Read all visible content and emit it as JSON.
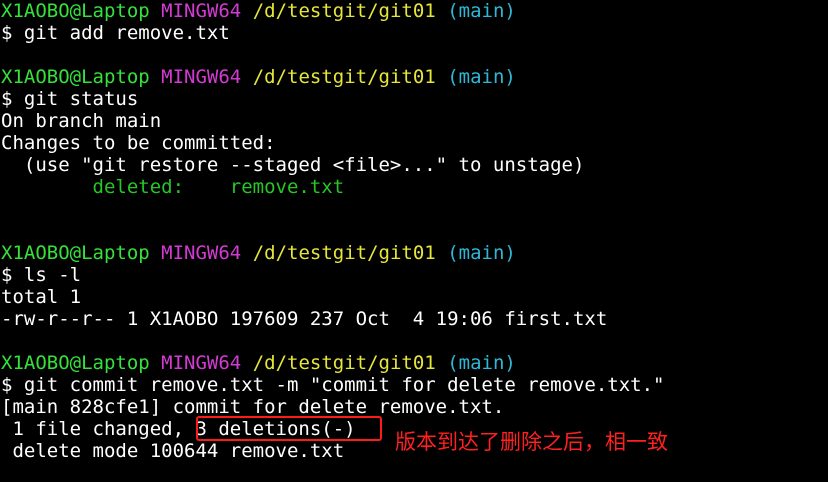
{
  "prompt": {
    "user_host": "X1AOBO@Laptop",
    "system": "MINGW64",
    "path": "/d/testgit/git01",
    "branch": "(main)"
  },
  "lines": {
    "cmd_add": "$ git add remove.txt",
    "cmd_status": "$ git status",
    "status_branch": "On branch main",
    "status_changes": "Changes to be committed:",
    "status_hint": "  (use \"git restore --staged <file>...\" to unstage)",
    "status_deleted_label": "        deleted:    ",
    "status_deleted_file": "remove.txt",
    "cmd_ls": "$ ls -l",
    "ls_total": "total 1",
    "ls_entry": "-rw-r--r-- 1 X1AOBO 197609 237 Oct  4 19:06 first.txt",
    "cmd_commit": "$ git commit remove.txt -m \"commit for delete remove.txt.\"",
    "commit_result": "[main 828cfe1] commit for delete remove.txt.",
    "commit_changed_prefix": " 1 file changed, ",
    "commit_deletions": "3 deletions(-)",
    "commit_delete_mode": " delete mode 100644 remove.txt"
  },
  "annotation": {
    "text": "版本到达了删除之后，相一致",
    "color": "#ff2020"
  },
  "colors": {
    "background": "#000000",
    "foreground": "#ffffff",
    "user_host": "#34e23a",
    "system": "#d43ad4",
    "path": "#e6e63a",
    "branch": "#2fb8d6",
    "staged": "#26c626"
  }
}
